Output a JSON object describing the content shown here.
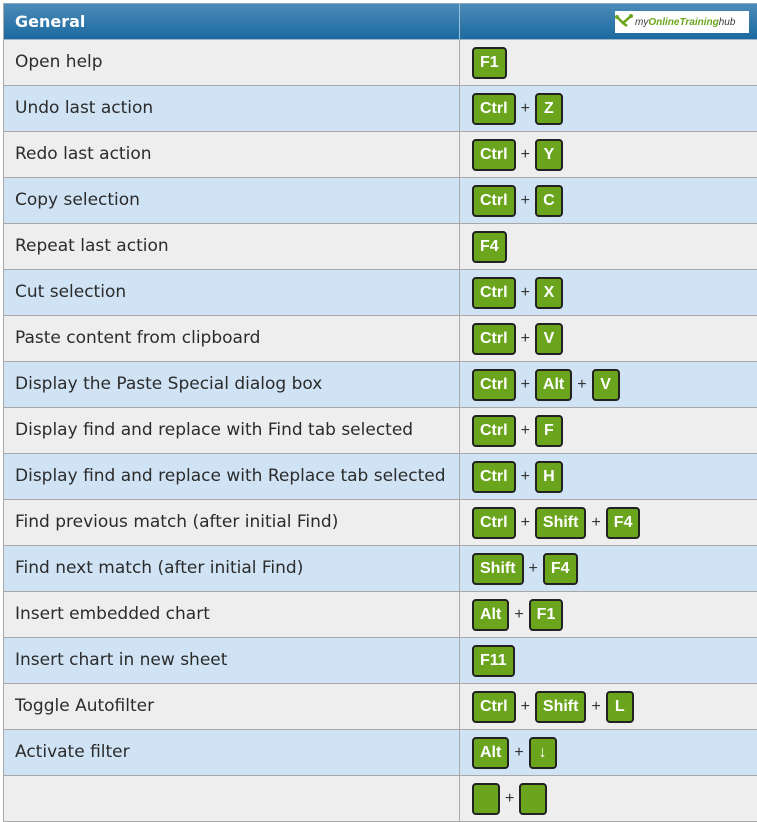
{
  "header": {
    "title": "General",
    "logo": {
      "part1": "my",
      "part2": "OnlineTraining",
      "part3": "hub"
    }
  },
  "colors": {
    "key_bg": "#6aa51d",
    "header_bg": "#1c6aa0",
    "row_odd": "#eeeeee",
    "row_even": "#d0e3f5"
  },
  "plus": "+",
  "rows": [
    {
      "desc": "Open help",
      "keys": [
        "F1"
      ]
    },
    {
      "desc": "Undo last action",
      "keys": [
        "Ctrl",
        "Z"
      ]
    },
    {
      "desc": "Redo last action",
      "keys": [
        "Ctrl",
        "Y"
      ]
    },
    {
      "desc": "Copy selection",
      "keys": [
        "Ctrl",
        "C"
      ]
    },
    {
      "desc": "Repeat last action",
      "keys": [
        "F4"
      ]
    },
    {
      "desc": "Cut selection",
      "keys": [
        "Ctrl",
        "X"
      ]
    },
    {
      "desc": "Paste content from clipboard",
      "keys": [
        "Ctrl",
        "V"
      ]
    },
    {
      "desc": "Display the Paste Special dialog box",
      "keys": [
        "Ctrl",
        "Alt",
        "V"
      ]
    },
    {
      "desc": "Display find and replace with Find tab selected",
      "keys": [
        "Ctrl",
        "F"
      ]
    },
    {
      "desc": "Display find and replace with Replace tab selected",
      "keys": [
        "Ctrl",
        "H"
      ]
    },
    {
      "desc": "Find previous match (after initial Find)",
      "keys": [
        "Ctrl",
        "Shift",
        "F4"
      ]
    },
    {
      "desc": "Find next match (after initial Find)",
      "keys": [
        "Shift",
        "F4"
      ]
    },
    {
      "desc": "Insert embedded chart",
      "keys": [
        "Alt",
        "F1"
      ]
    },
    {
      "desc": "Insert chart in new sheet",
      "keys": [
        "F11"
      ]
    },
    {
      "desc": "Toggle Autofilter",
      "keys": [
        "Ctrl",
        "Shift",
        "L"
      ]
    },
    {
      "desc": "Activate filter",
      "keys": [
        "Alt",
        "↓"
      ]
    },
    {
      "desc": "",
      "keys": [
        "",
        ""
      ]
    }
  ]
}
